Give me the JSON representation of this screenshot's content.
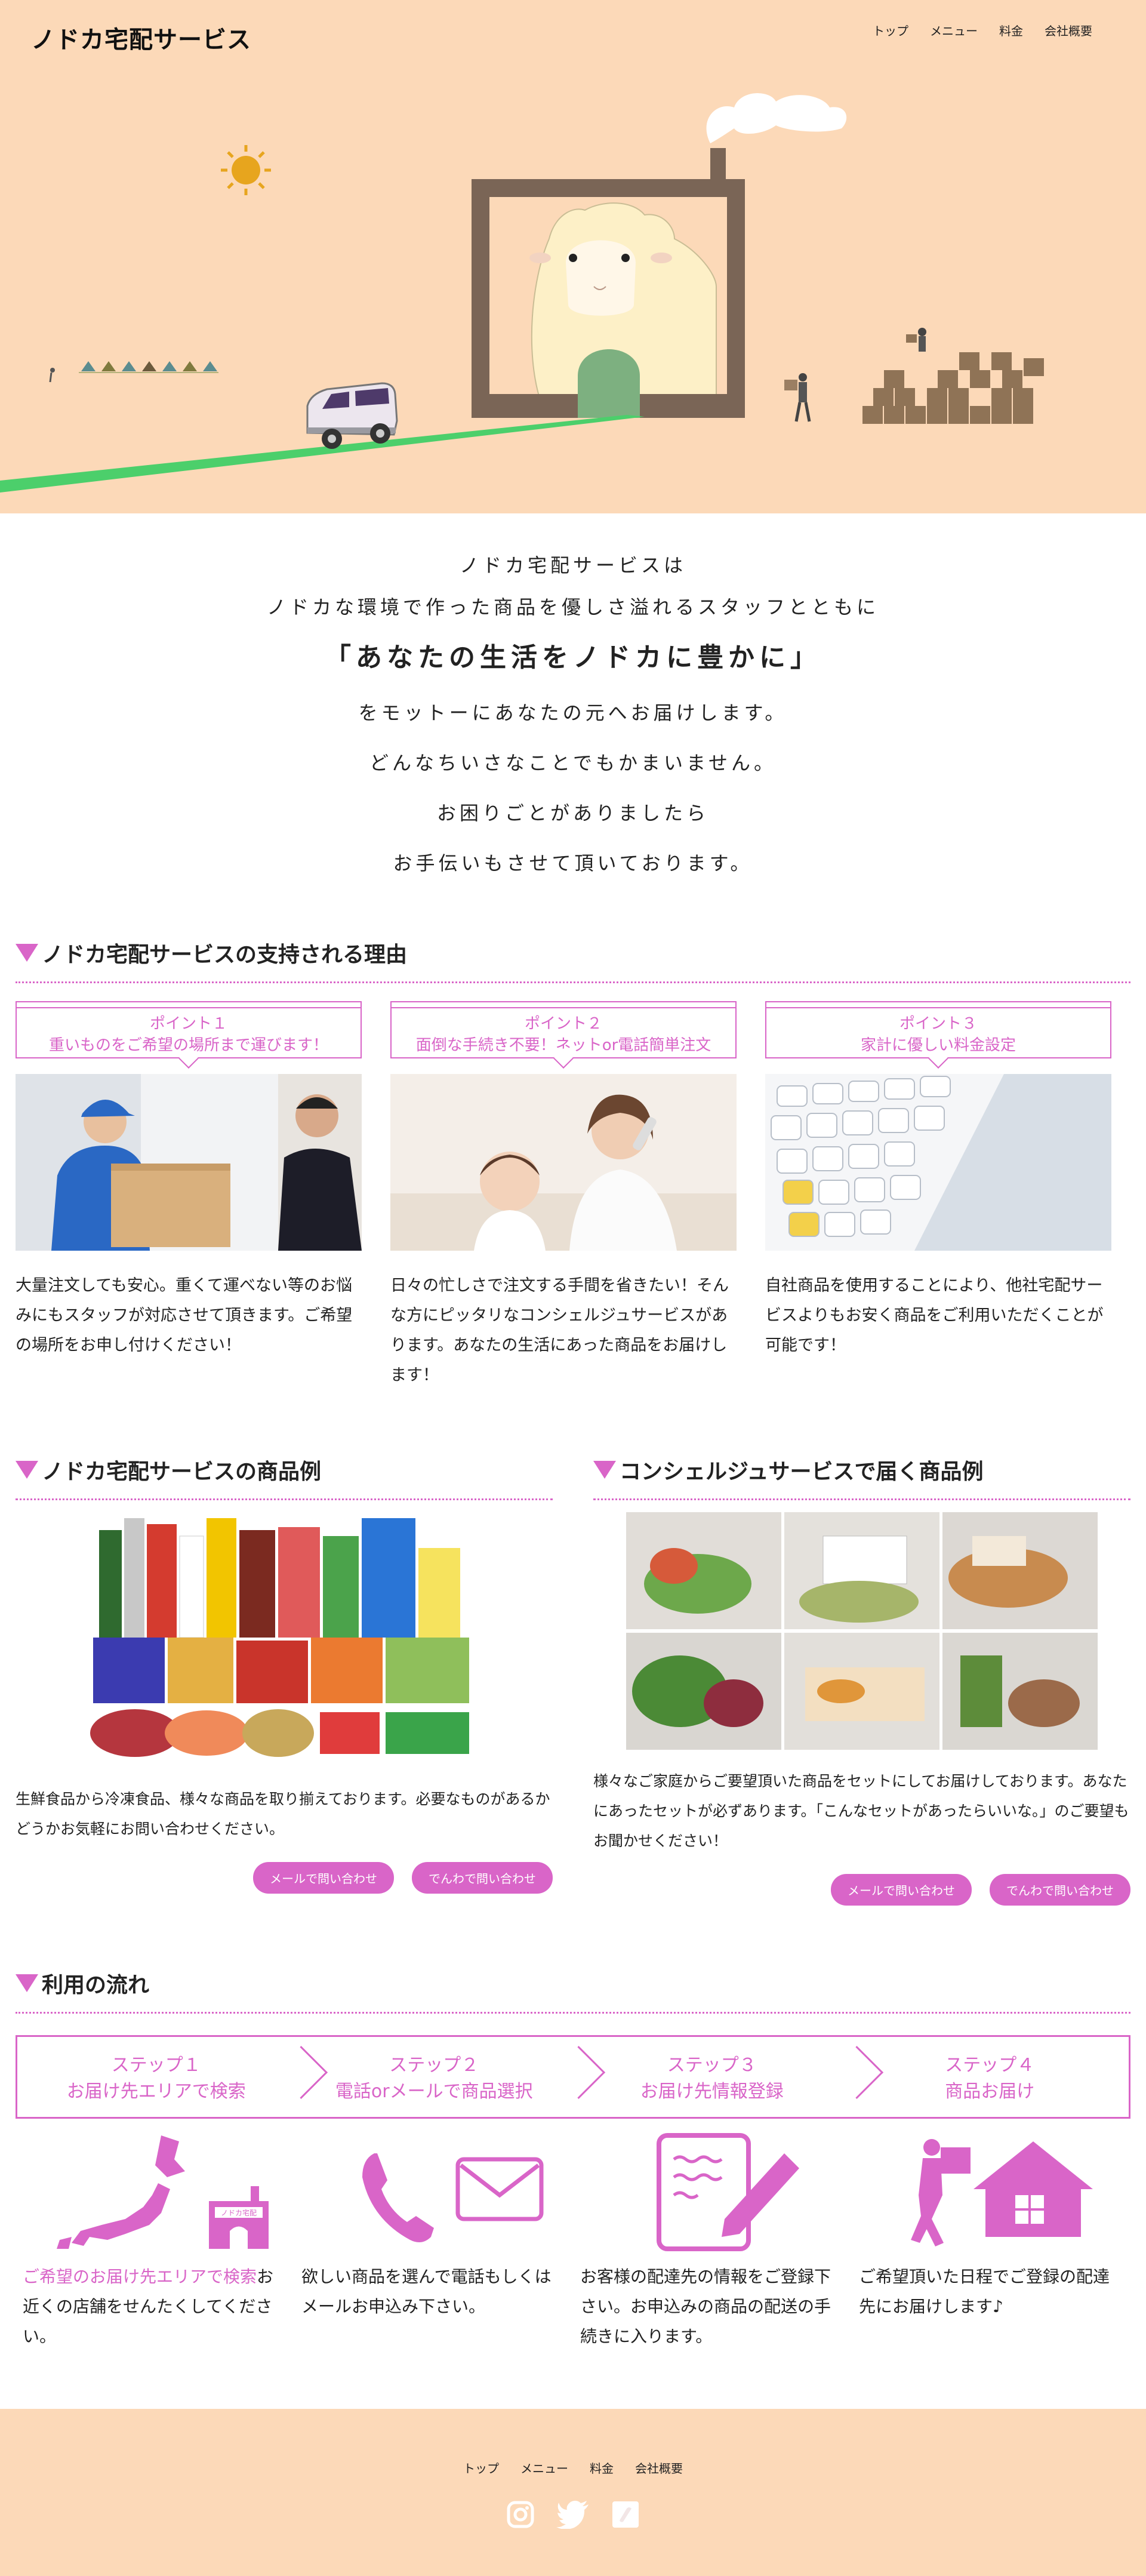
{
  "header": {
    "logo": "ノドカ宅配サービス",
    "nav": [
      "トップ",
      "メニュー",
      "料金",
      "会社概要"
    ]
  },
  "intro": {
    "line1": "ノドカ宅配サービスは",
    "line2": "ノドカな環境で作った商品を優しさ溢れるスタッフとともに",
    "motto": "「あなたの生活をノドカに豊かに」",
    "line3": "をモットーにあなたの元へお届けします。",
    "line4": "どんなちいさなことでもかまいません。",
    "line5": "お困りごとがありましたら",
    "line6": "お手伝いもさせて頂いております。"
  },
  "reasons": {
    "title": "ノドカ宅配サービスの支持される理由",
    "points": [
      {
        "label": "ポイント１",
        "title": "重いものをご希望の場所まで運びます！",
        "text": "大量注文しても安心。重くて運べない等のお悩みにもスタッフが対応させて頂きます。ご希望の場所をお申し付けください！"
      },
      {
        "label": "ポイント２",
        "title": "面倒な手続き不要！ネットor電話簡単注文",
        "text": "日々の忙しさで注文する手間を省きたい！そんな方にピッタリなコンシェルジュサービスがあります。あなたの生活にあった商品をお届けします！"
      },
      {
        "label": "ポイント３",
        "title": "家計に優しい料金設定",
        "text": "自社商品を使用することにより、他社宅配サービスよりもお安く商品をご利用いただくことが可能です！"
      }
    ]
  },
  "products": {
    "left": {
      "title": "ノドカ宅配サービスの商品例",
      "text": "生鮮食品から冷凍食品、様々な商品を取り揃えております。必要なものがあるかどうかお気軽にお問い合わせください。"
    },
    "right": {
      "title": "コンシェルジュサービスで届く商品例",
      "text": "様々なご家庭からご要望頂いた商品をセットにしてお届けしております。あなたにあったセットが必ずあります。「こんなセットがあったらいいな。」のご要望もお聞かせください！"
    },
    "mail_button": "メールで問い合わせ",
    "phone_button": "でんわで問い合わせ"
  },
  "flow": {
    "title": "利用の流れ",
    "steps": [
      {
        "label": "ステップ１",
        "title": "お届け先エリアで検索",
        "highlight": "ご希望のお届け先エリアで検索",
        "text": "お近くの店舗をせんたくしてください。"
      },
      {
        "label": "ステップ２",
        "title": "電話orメールで商品選択",
        "highlight": "",
        "text": "欲しい商品を選んで電話もしくはメールお申込み下さい。"
      },
      {
        "label": "ステップ３",
        "title": "お届け先情報登録",
        "highlight": "",
        "text": "お客様の配達先の情報をご登録下さい。お申込みの商品の配送の手続きに入ります。"
      },
      {
        "label": "ステップ４",
        "title": "商品お届け",
        "highlight": "",
        "text": "ご希望頂いた日程でご登録の配達先にお届けします♪"
      }
    ],
    "map_shop_label": "ノドカ宅配"
  },
  "footer": {
    "nav": [
      "トップ",
      "メニュー",
      "料金",
      "会社概要"
    ],
    "social": [
      "instagram-icon",
      "twitter-icon",
      "app-icon"
    ]
  },
  "colors": {
    "accent": "#d965c8",
    "peach": "#fcd9b8",
    "green": "#4ccf6b"
  }
}
